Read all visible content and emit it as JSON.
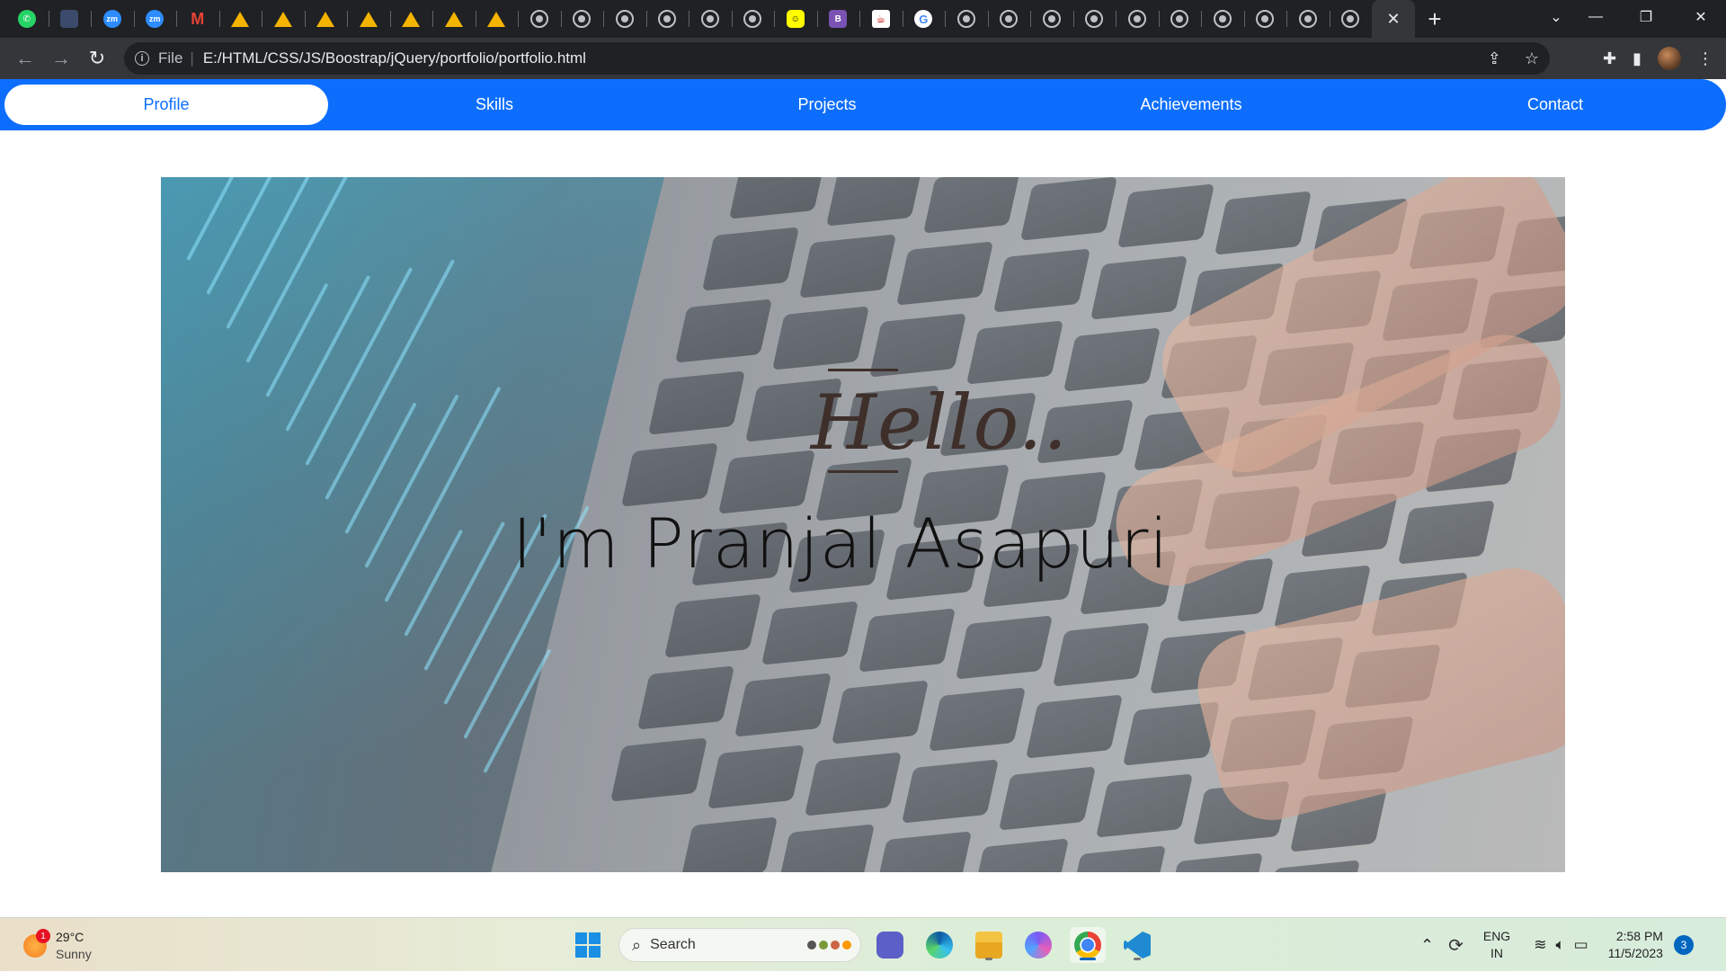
{
  "browser": {
    "tabs": [
      {
        "icon": "whatsapp-icon",
        "type": "wa",
        "glyph": "✆"
      },
      {
        "icon": "cat-icon",
        "type": "cat",
        "glyph": ""
      },
      {
        "icon": "zoom-icon",
        "type": "zm",
        "glyph": "zm"
      },
      {
        "icon": "zoom-icon",
        "type": "zm",
        "glyph": "zm"
      },
      {
        "icon": "gmail-icon",
        "type": "gm",
        "glyph": "M"
      },
      {
        "icon": "google-drive-icon",
        "type": "dr",
        "glyph": ""
      },
      {
        "icon": "google-drive-icon",
        "type": "dr",
        "glyph": ""
      },
      {
        "icon": "google-drive-icon",
        "type": "dr",
        "glyph": ""
      },
      {
        "icon": "google-drive-icon",
        "type": "dr",
        "glyph": ""
      },
      {
        "icon": "google-drive-icon",
        "type": "dr",
        "glyph": ""
      },
      {
        "icon": "google-drive-icon",
        "type": "dr",
        "glyph": ""
      },
      {
        "icon": "google-drive-icon",
        "type": "dr",
        "glyph": ""
      },
      {
        "icon": "globe-icon",
        "type": "globe",
        "glyph": ""
      },
      {
        "icon": "globe-icon",
        "type": "globe",
        "glyph": ""
      },
      {
        "icon": "globe-icon",
        "type": "globe",
        "glyph": ""
      },
      {
        "icon": "globe-icon",
        "type": "globe",
        "glyph": ""
      },
      {
        "icon": "globe-icon",
        "type": "globe",
        "glyph": ""
      },
      {
        "icon": "globe-icon",
        "type": "globe",
        "glyph": ""
      },
      {
        "icon": "snapchat-icon",
        "type": "sc",
        "glyph": "☺"
      },
      {
        "icon": "bootstrap-icon",
        "type": "bs",
        "glyph": "B"
      },
      {
        "icon": "coffee-cup-icon",
        "type": "cup",
        "glyph": "☕"
      },
      {
        "icon": "google-icon",
        "type": "gg",
        "glyph": "G"
      },
      {
        "icon": "globe-icon",
        "type": "globe",
        "glyph": ""
      },
      {
        "icon": "globe-icon",
        "type": "globe",
        "glyph": ""
      },
      {
        "icon": "globe-icon",
        "type": "globe",
        "glyph": ""
      },
      {
        "icon": "globe-icon",
        "type": "globe",
        "glyph": ""
      },
      {
        "icon": "globe-icon",
        "type": "globe",
        "glyph": ""
      },
      {
        "icon": "globe-icon",
        "type": "globe",
        "glyph": ""
      },
      {
        "icon": "globe-icon",
        "type": "globe",
        "glyph": ""
      },
      {
        "icon": "globe-icon",
        "type": "globe",
        "glyph": ""
      },
      {
        "icon": "globe-icon",
        "type": "globe",
        "glyph": ""
      },
      {
        "icon": "globe-icon",
        "type": "globe",
        "glyph": ""
      }
    ],
    "address": {
      "scheme_label": "File",
      "url": "E:/HTML/CSS/JS/Boostrap/jQuery/portfolio/portfolio.html"
    }
  },
  "page": {
    "nav": {
      "items": [
        {
          "label": "Profile",
          "active": true
        },
        {
          "label": "Skills",
          "active": false
        },
        {
          "label": "Projects",
          "active": false
        },
        {
          "label": "Achievements",
          "active": false
        },
        {
          "label": "Contact",
          "active": false
        }
      ]
    },
    "hero": {
      "greeting": "Hello..",
      "name": "I'm Pranjal Asapuri"
    }
  },
  "taskbar": {
    "weather": {
      "temp": "29°C",
      "condition": "Sunny",
      "badge": "1"
    },
    "search_label": "Search",
    "tray": {
      "lang_top": "ENG",
      "lang_bottom": "IN",
      "time": "2:58 PM",
      "date": "11/5/2023",
      "notifications": "3"
    }
  },
  "colors": {
    "nav_bg": "#0d6efd",
    "nav_active_text": "#0d6efd",
    "greeting": "#3f2f2b"
  }
}
